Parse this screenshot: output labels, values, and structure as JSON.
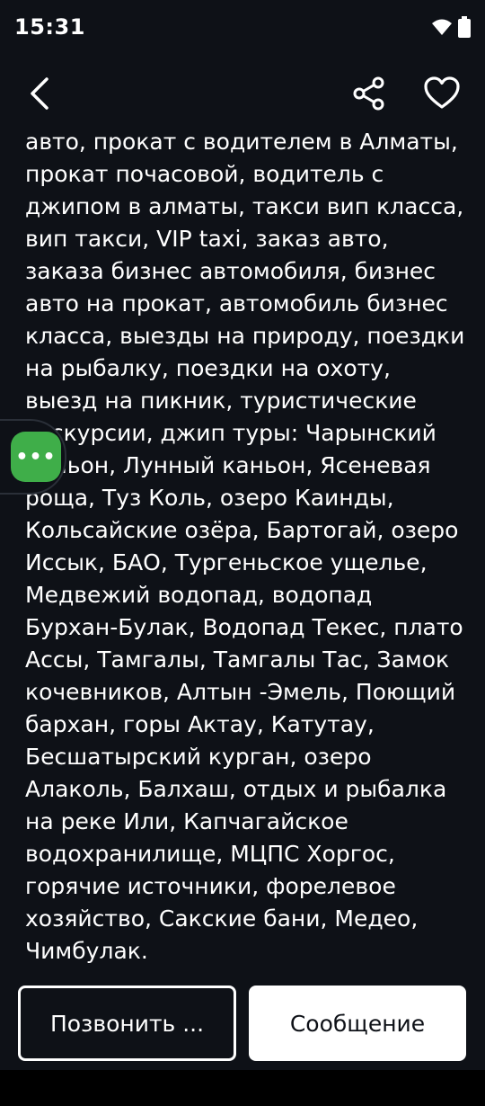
{
  "status_bar": {
    "time": "15:31",
    "icons": [
      "wifi-icon",
      "battery-icon"
    ]
  },
  "toolbar": {
    "back_icon": "chevron-left-icon",
    "share_icon": "share-icon",
    "favorite_icon": "heart-outline-icon"
  },
  "content": {
    "text": "авто, прокат с водителем в Алматы, прокат почасовой, водитель с джипом в алматы, такси вип класса, вип такси, VIP taxi, заказ авто, заказа бизнес автомобиля, бизнес авто на прокат, автомобиль бизнес класса, выезды на природу, поездки на рыбалку, поездки на охоту, выезд на пикник, туристические экскурсии, джип туры: Чарынский каньон, Лунный каньон, Ясеневая роща, Туз Коль, озеро Каинды, Кольсайские озёра, Бартогай, озеро Иссык, БАО, Тургеньское ущелье, Медвежий водопад, водопад Бурхан-Булак, Водопад Текес, плато Ассы, Тамгалы, Тамгалы Тас, Замок кочевников, Алтын -Эмель, Поющий бархан, горы Актау, Катутау, Бесшатырский курган, озеро Алаколь, Балхаш, отдых и рыбалка на реке Или, Капчагайское водохранилище, МЦПС Хоргос, горячие источники, форелевое хозяйство, Сакские бани, Медео, Чимбулак."
  },
  "fab": {
    "label": "•••",
    "color": "#3fae49"
  },
  "actions": {
    "call_label": "Позвонить ...",
    "message_label": "Сообщение"
  },
  "colors": {
    "background": "#0e1117",
    "accent_green": "#3fae49"
  }
}
